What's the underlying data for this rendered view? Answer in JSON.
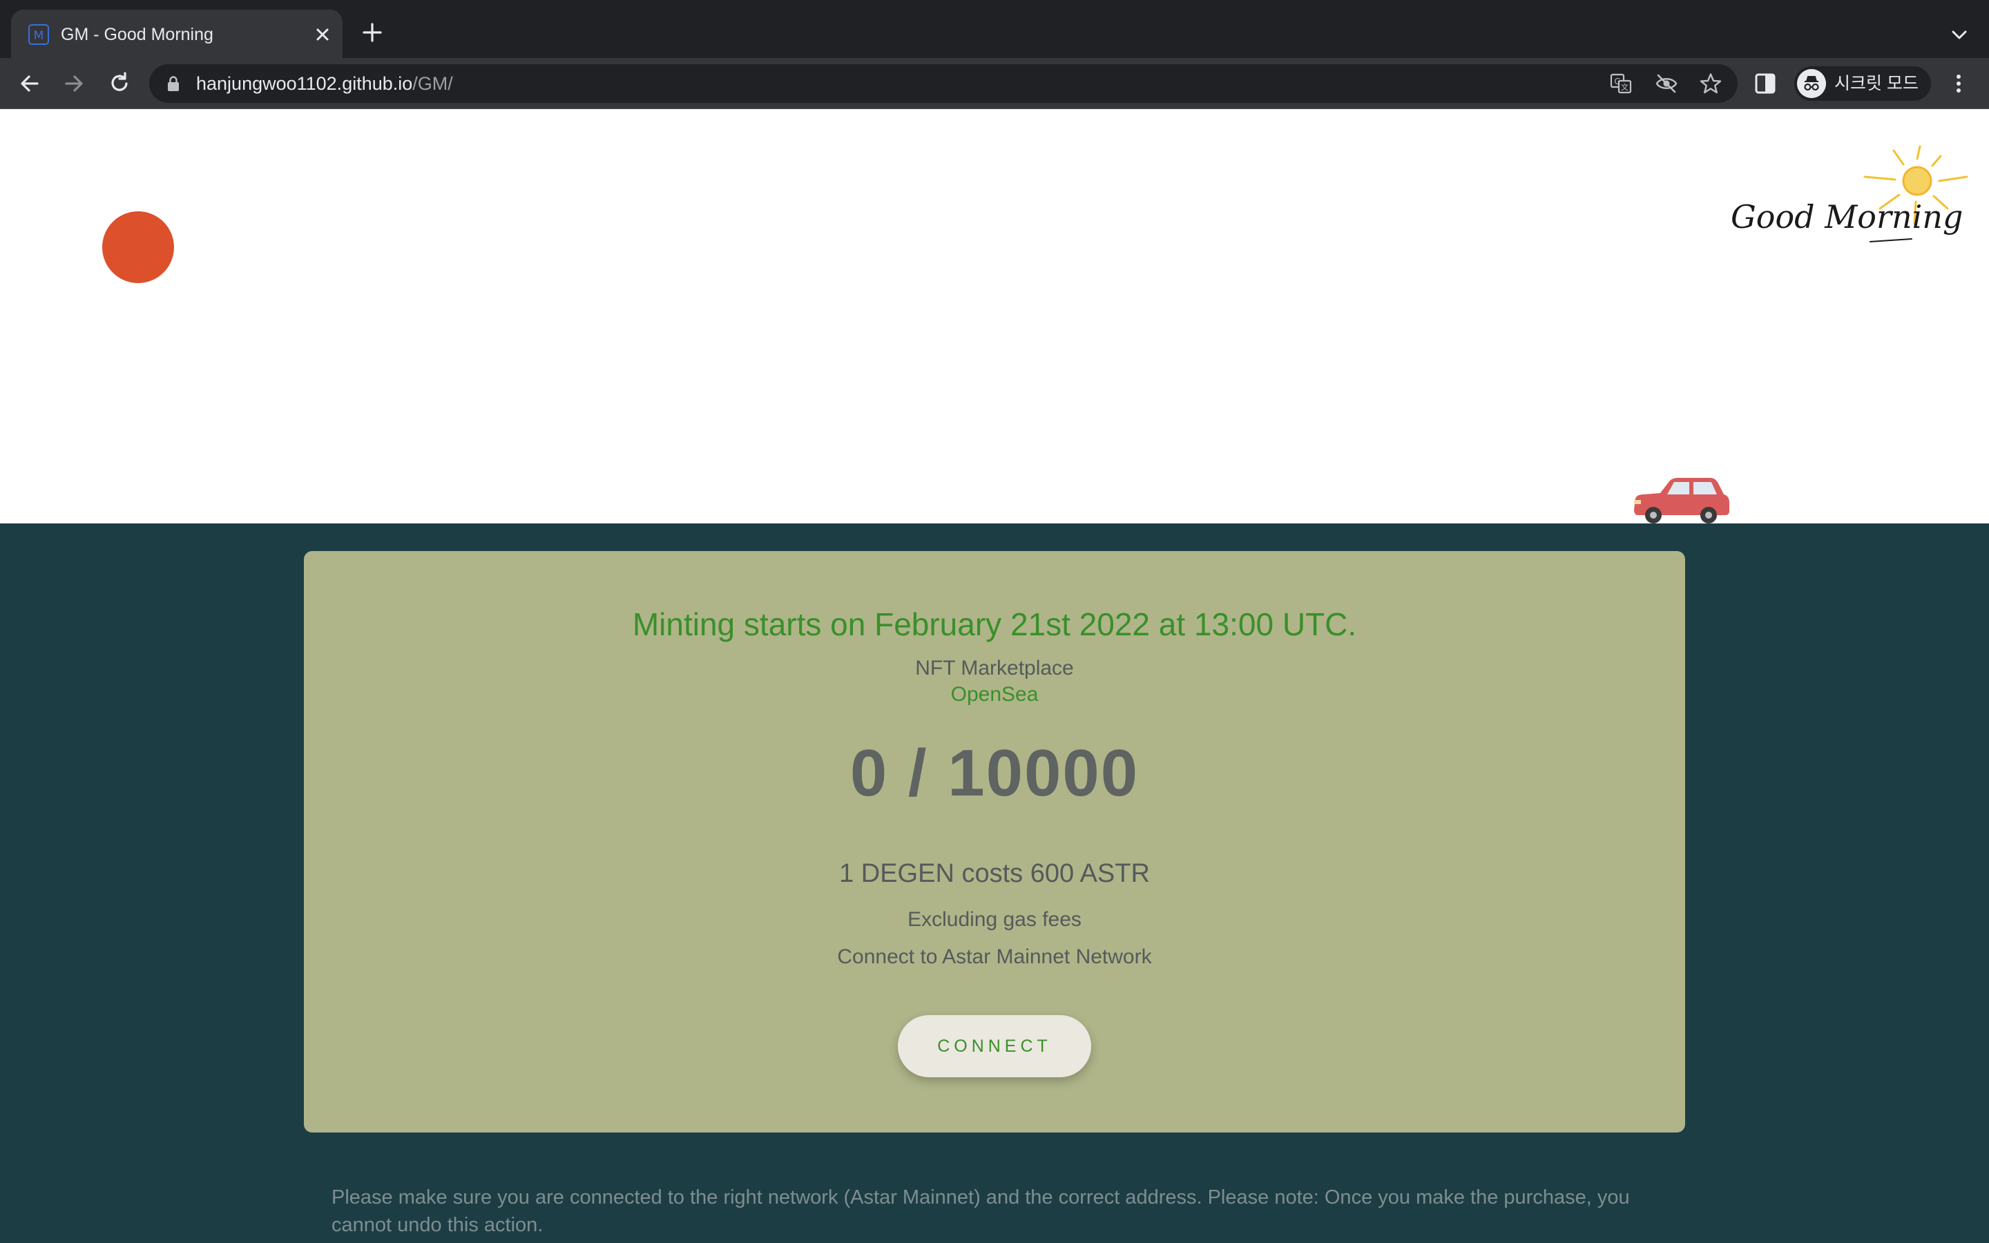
{
  "browser": {
    "tab": {
      "title": "GM - Good Morning",
      "favicon": "gm-favicon-icon"
    },
    "url": {
      "host": "hanjungwoo1102.github.io",
      "path": "/GM/"
    },
    "profile": {
      "label": "시크릿 모드",
      "icon": "incognito-icon"
    },
    "icons": [
      "back-arrow-icon",
      "forward-arrow-icon",
      "reload-icon",
      "lock-icon",
      "translate-icon",
      "eye-off-icon",
      "star-icon",
      "side-panel-icon",
      "kebab-menu-icon",
      "tab-search-chevron-icon",
      "new-tab-plus-icon",
      "close-icon"
    ]
  },
  "hero": {
    "art_text": "Good Morning",
    "colors": {
      "ball": "#dc502c",
      "sun": "#f2c230",
      "car": "#d95a5a"
    }
  },
  "card": {
    "headline": "Minting starts on February 21st 2022 at 13:00 UTC.",
    "marketplace_label": "NFT Marketplace",
    "marketplace_link": "OpenSea",
    "count": "0 / 10000",
    "price": "1 DEGEN costs 600 ASTR",
    "gas_note": "Excluding gas fees",
    "network_note": "Connect to Astar Mainnet Network",
    "connect_label": "CONNECT"
  },
  "footer": {
    "note": "Please make sure you are connected to the right network (Astar Mainnet) and the correct address. Please note: Once you make the purchase, you cannot undo this action."
  },
  "colors": {
    "page_bg": "#1d3d44",
    "card_bg": "#afb589",
    "accent_green": "#3a8f2a",
    "button_bg": "#eae8df"
  }
}
